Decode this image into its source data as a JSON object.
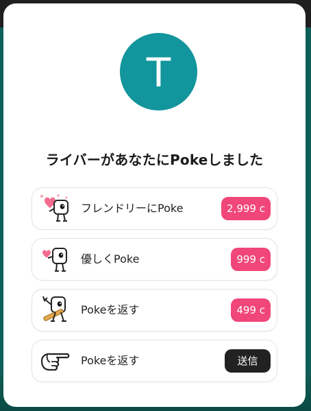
{
  "avatar": {
    "initial": "T",
    "color": "#12959c"
  },
  "title": "ライバーがあなたにPokeしました",
  "colors": {
    "price_badge": "#f0467a",
    "send_button": "#222222"
  },
  "options": [
    {
      "icon": "mascot-hearts-icon",
      "label": "フレンドリーにPoke",
      "price": "2,999 c"
    },
    {
      "icon": "mascot-heart-icon",
      "label": "優しくPoke",
      "price": "999 c"
    },
    {
      "icon": "mascot-dance-icon",
      "label": "Pokeを返す",
      "price": "499 c"
    },
    {
      "icon": "pointing-hand-icon",
      "label": "Pokeを返す",
      "button": "送信"
    }
  ]
}
